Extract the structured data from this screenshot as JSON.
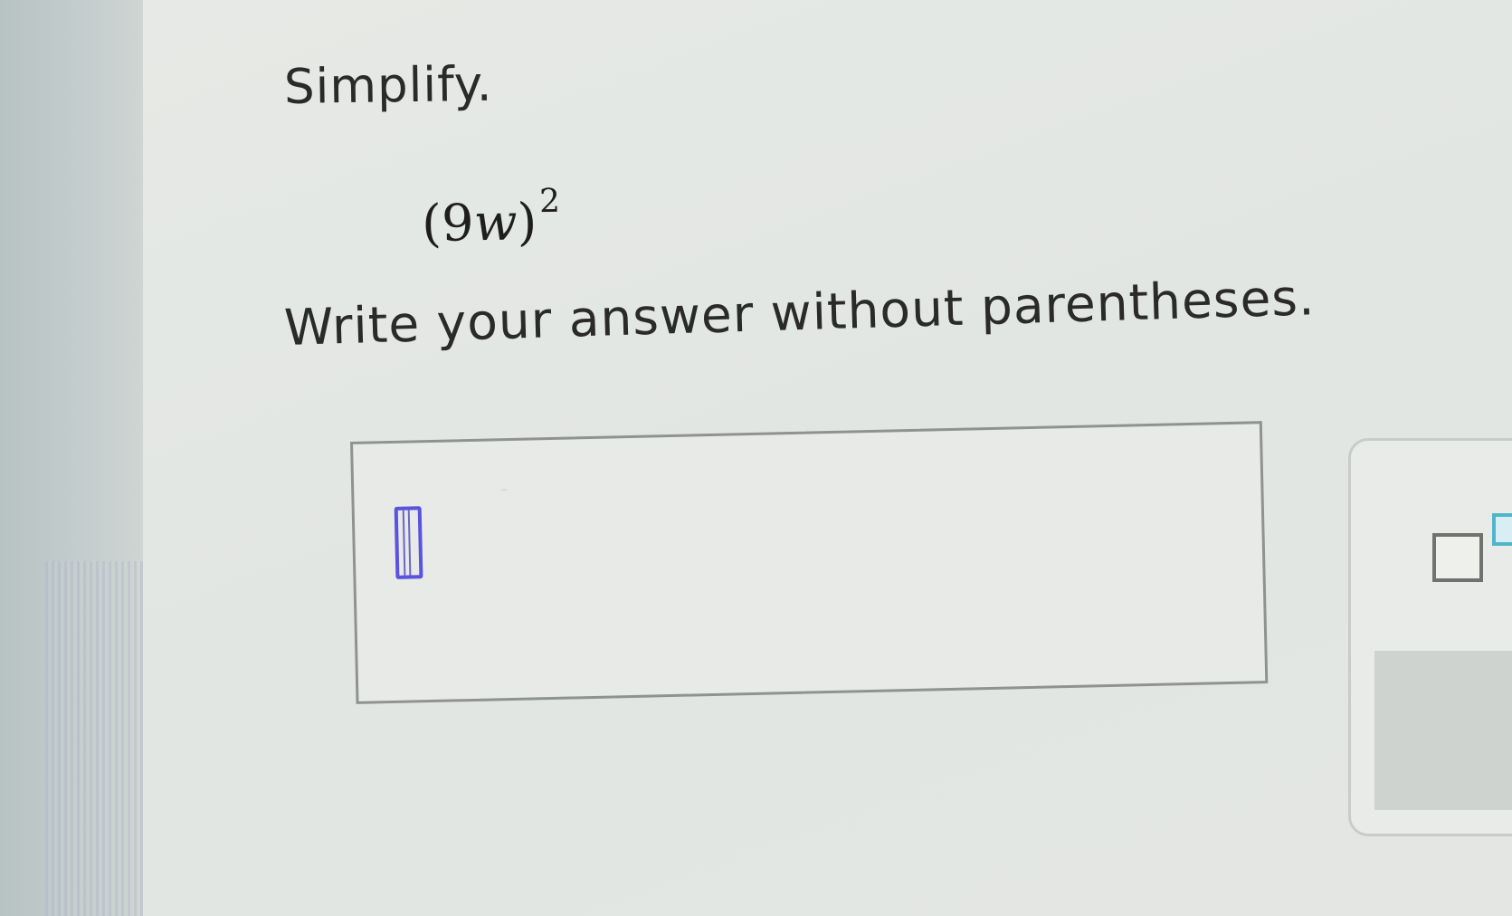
{
  "problem": {
    "prompt_title": "Simplify.",
    "expression": {
      "base_coefficient": "9",
      "base_variable": "w",
      "exponent": "2",
      "open_paren": "(",
      "close_paren": ")"
    },
    "instruction": "Write your answer without parentheses."
  },
  "answer": {
    "value": ""
  },
  "toolbar": {
    "icons": [
      "exponent-template-icon"
    ]
  },
  "colors": {
    "cursor": "#5a52e0",
    "exponent_accent": "#4fb6c9",
    "text": "#2a2a2a"
  }
}
